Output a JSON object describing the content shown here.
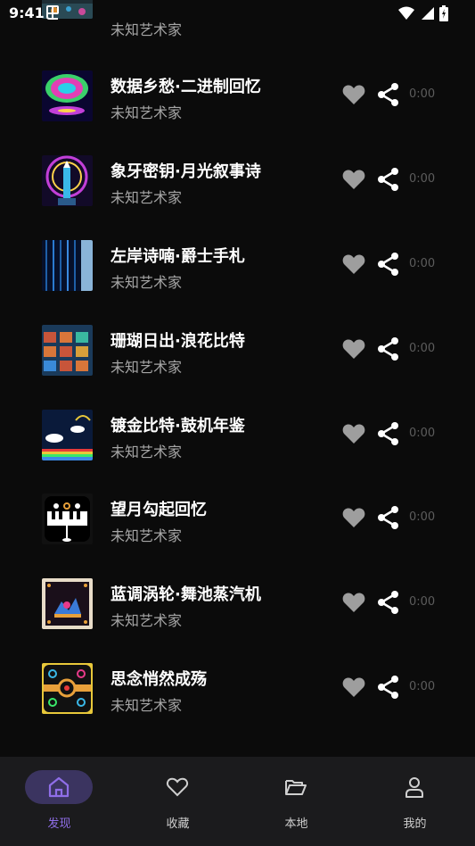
{
  "status_bar": {
    "time": "9:41"
  },
  "tracks": [
    {
      "title": "",
      "artist": "未知艺术家",
      "duration": ""
    },
    {
      "title": "数据乡愁·二进制回忆",
      "artist": "未知艺术家",
      "duration": "0:00"
    },
    {
      "title": "象牙密钥·月光叙事诗",
      "artist": "未知艺术家",
      "duration": "0:00"
    },
    {
      "title": "左岸诗喃·爵士手札",
      "artist": "未知艺术家",
      "duration": "0:00"
    },
    {
      "title": "珊瑚日出·浪花比特",
      "artist": "未知艺术家",
      "duration": "0:00"
    },
    {
      "title": "镀金比特·鼓机年鉴",
      "artist": "未知艺术家",
      "duration": "0:00"
    },
    {
      "title": "望月勾起回忆",
      "artist": "未知艺术家",
      "duration": "0:00"
    },
    {
      "title": "蓝调涡轮·舞池蒸汽机",
      "artist": "未知艺术家",
      "duration": "0:00"
    },
    {
      "title": "思念悄然成殇",
      "artist": "未知艺术家",
      "duration": "0:00"
    }
  ],
  "bottom_nav": {
    "items": [
      {
        "label": "发现",
        "icon": "home-icon",
        "active": true
      },
      {
        "label": "收藏",
        "icon": "heart-outline-icon",
        "active": false
      },
      {
        "label": "本地",
        "icon": "folder-open-icon",
        "active": false
      },
      {
        "label": "我的",
        "icon": "person-icon",
        "active": false
      }
    ]
  },
  "colors": {
    "accent": "#8f6ee8",
    "nav_pill": "#3b3460",
    "background": "#0b0b0b",
    "nav_background": "#1b1b1d",
    "icon_gray": "#9e9e9e"
  }
}
